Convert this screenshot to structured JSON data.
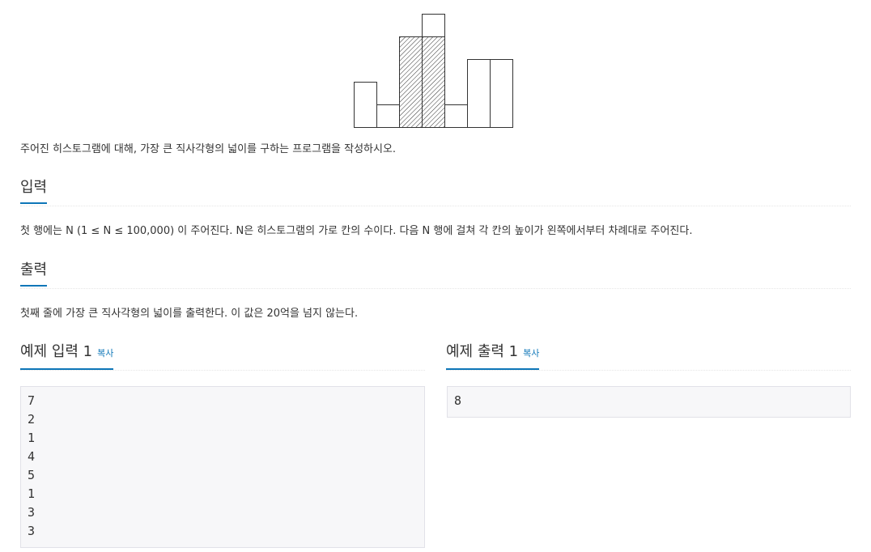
{
  "problem": {
    "description": "주어진 히스토그램에 대해, 가장 큰 직사각형의 넓이를 구하는 프로그램을 작성하시오.",
    "input_title": "입력",
    "input_text": "첫 행에는 N (1 ≤ N ≤ 100,000) 이 주어진다. N은 히스토그램의 가로 칸의 수이다. 다음 N 행에 걸쳐 각 칸의 높이가 왼쪽에서부터 차례대로 주어진다.",
    "output_title": "출력",
    "output_text": "첫째 줄에 가장 큰 직사각형의 넓이를 출력한다. 이 값은 20억을 넘지 않는다."
  },
  "examples": {
    "input_title": "예제 입력 1",
    "output_title": "예제 출력 1",
    "copy_label": "복사",
    "input_lines": [
      "7",
      "2",
      "1",
      "4",
      "5",
      "1",
      "3",
      "3"
    ],
    "output_lines": [
      "8"
    ]
  },
  "histogram": {
    "heights": [
      2,
      1,
      4,
      5,
      1,
      3,
      3
    ],
    "highlight": {
      "start": 2,
      "end": 3,
      "height": 4
    }
  },
  "colors": {
    "accent": "#0e76b8",
    "text": "#333333",
    "pre_bg": "#f7f7f9"
  }
}
